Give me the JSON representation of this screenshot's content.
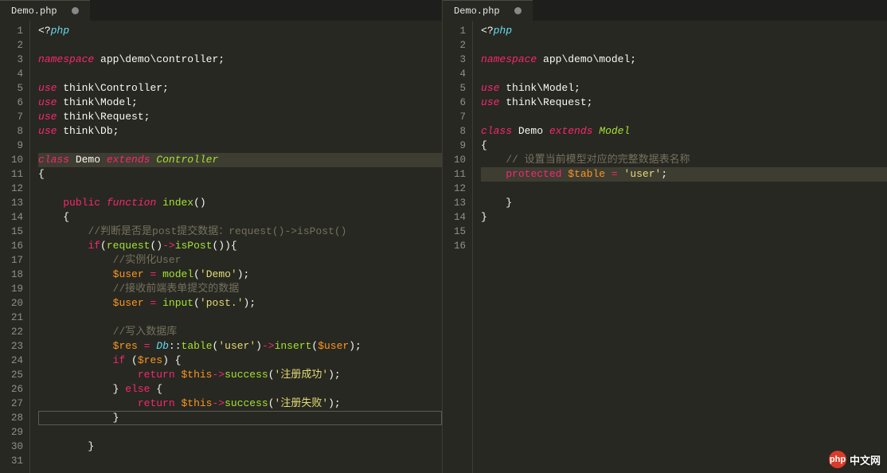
{
  "left": {
    "tab_label": "Demo.php",
    "line_count": 31,
    "lines": [
      {
        "n": 1,
        "t": [
          {
            "c": "tk-ident",
            "v": "<?"
          },
          {
            "c": "tk-kwblue",
            "v": "php"
          }
        ]
      },
      {
        "n": 2,
        "t": []
      },
      {
        "n": 3,
        "t": [
          {
            "c": "tk-kw",
            "v": "namespace"
          },
          {
            "c": "tk-ident",
            "v": " app\\demo\\controller;"
          }
        ]
      },
      {
        "n": 4,
        "t": []
      },
      {
        "n": 5,
        "t": [
          {
            "c": "tk-kw",
            "v": "use"
          },
          {
            "c": "tk-ident",
            "v": " think\\Controller;"
          }
        ]
      },
      {
        "n": 6,
        "t": [
          {
            "c": "tk-kw",
            "v": "use"
          },
          {
            "c": "tk-ident",
            "v": " think\\Model;"
          }
        ]
      },
      {
        "n": 7,
        "t": [
          {
            "c": "tk-kw",
            "v": "use"
          },
          {
            "c": "tk-ident",
            "v": " think\\Request;"
          }
        ]
      },
      {
        "n": 8,
        "t": [
          {
            "c": "tk-kw",
            "v": "use"
          },
          {
            "c": "tk-ident",
            "v": " think\\Db;"
          }
        ]
      },
      {
        "n": 9,
        "t": []
      },
      {
        "n": 10,
        "t": [
          {
            "c": "tk-kw",
            "v": "class"
          },
          {
            "c": "tk-ident",
            "v": " Demo "
          },
          {
            "c": "tk-kw",
            "v": "extends"
          },
          {
            "c": "tk-ident",
            "v": " "
          },
          {
            "c": "tk-cls",
            "v": "Controller"
          }
        ],
        "hl": true
      },
      {
        "n": 11,
        "t": [
          {
            "c": "tk-ident",
            "v": "{"
          }
        ]
      },
      {
        "n": 12,
        "t": []
      },
      {
        "n": 13,
        "t": [
          {
            "c": "tk-ident",
            "v": "    "
          },
          {
            "c": "tk-kw2",
            "v": "public"
          },
          {
            "c": "tk-ident",
            "v": " "
          },
          {
            "c": "tk-kw",
            "v": "function"
          },
          {
            "c": "tk-ident",
            "v": " "
          },
          {
            "c": "tk-fn",
            "v": "index"
          },
          {
            "c": "tk-ident",
            "v": "()"
          }
        ]
      },
      {
        "n": 14,
        "t": [
          {
            "c": "tk-ident",
            "v": "    {"
          }
        ]
      },
      {
        "n": 15,
        "t": [
          {
            "c": "tk-ident",
            "v": "        "
          },
          {
            "c": "tk-cmt",
            "v": "//判断是否是post提交数据：request()->isPost()"
          }
        ]
      },
      {
        "n": 16,
        "t": [
          {
            "c": "tk-ident",
            "v": "        "
          },
          {
            "c": "tk-kw2",
            "v": "if"
          },
          {
            "c": "tk-ident",
            "v": "("
          },
          {
            "c": "tk-fn",
            "v": "request"
          },
          {
            "c": "tk-ident",
            "v": "()"
          },
          {
            "c": "tk-op",
            "v": "->"
          },
          {
            "c": "tk-fn",
            "v": "isPost"
          },
          {
            "c": "tk-ident",
            "v": "()){"
          }
        ]
      },
      {
        "n": 17,
        "t": [
          {
            "c": "tk-ident",
            "v": "            "
          },
          {
            "c": "tk-cmt",
            "v": "//实例化User"
          }
        ]
      },
      {
        "n": 18,
        "t": [
          {
            "c": "tk-ident",
            "v": "            "
          },
          {
            "c": "tk-var",
            "v": "$user"
          },
          {
            "c": "tk-ident",
            "v": " "
          },
          {
            "c": "tk-op",
            "v": "="
          },
          {
            "c": "tk-ident",
            "v": " "
          },
          {
            "c": "tk-fn",
            "v": "model"
          },
          {
            "c": "tk-ident",
            "v": "("
          },
          {
            "c": "tk-str",
            "v": "'Demo'"
          },
          {
            "c": "tk-ident",
            "v": ");"
          }
        ]
      },
      {
        "n": 19,
        "t": [
          {
            "c": "tk-ident",
            "v": "            "
          },
          {
            "c": "tk-cmt",
            "v": "//接收前端表单提交的数据"
          }
        ]
      },
      {
        "n": 20,
        "t": [
          {
            "c": "tk-ident",
            "v": "            "
          },
          {
            "c": "tk-var",
            "v": "$user"
          },
          {
            "c": "tk-ident",
            "v": " "
          },
          {
            "c": "tk-op",
            "v": "="
          },
          {
            "c": "tk-ident",
            "v": " "
          },
          {
            "c": "tk-fn",
            "v": "input"
          },
          {
            "c": "tk-ident",
            "v": "("
          },
          {
            "c": "tk-str",
            "v": "'post.'"
          },
          {
            "c": "tk-ident",
            "v": ");"
          }
        ]
      },
      {
        "n": 21,
        "t": []
      },
      {
        "n": 22,
        "t": [
          {
            "c": "tk-ident",
            "v": "            "
          },
          {
            "c": "tk-cmt",
            "v": "//写入数据库"
          }
        ]
      },
      {
        "n": 23,
        "t": [
          {
            "c": "tk-ident",
            "v": "            "
          },
          {
            "c": "tk-var",
            "v": "$res"
          },
          {
            "c": "tk-ident",
            "v": " "
          },
          {
            "c": "tk-op",
            "v": "="
          },
          {
            "c": "tk-ident",
            "v": " "
          },
          {
            "c": "tk-static",
            "v": "Db"
          },
          {
            "c": "tk-ident",
            "v": "::"
          },
          {
            "c": "tk-fn",
            "v": "table"
          },
          {
            "c": "tk-ident",
            "v": "("
          },
          {
            "c": "tk-str",
            "v": "'user'"
          },
          {
            "c": "tk-ident",
            "v": ")"
          },
          {
            "c": "tk-op",
            "v": "->"
          },
          {
            "c": "tk-fn",
            "v": "insert"
          },
          {
            "c": "tk-ident",
            "v": "("
          },
          {
            "c": "tk-var",
            "v": "$user"
          },
          {
            "c": "tk-ident",
            "v": ");"
          }
        ]
      },
      {
        "n": 24,
        "t": [
          {
            "c": "tk-ident",
            "v": "            "
          },
          {
            "c": "tk-kw2",
            "v": "if"
          },
          {
            "c": "tk-ident",
            "v": " ("
          },
          {
            "c": "tk-var",
            "v": "$res"
          },
          {
            "c": "tk-ident",
            "v": ") {"
          }
        ]
      },
      {
        "n": 25,
        "t": [
          {
            "c": "tk-ident",
            "v": "                "
          },
          {
            "c": "tk-kw2",
            "v": "return"
          },
          {
            "c": "tk-ident",
            "v": " "
          },
          {
            "c": "tk-var",
            "v": "$this"
          },
          {
            "c": "tk-op",
            "v": "->"
          },
          {
            "c": "tk-fn",
            "v": "success"
          },
          {
            "c": "tk-ident",
            "v": "("
          },
          {
            "c": "tk-str",
            "v": "'注册成功'"
          },
          {
            "c": "tk-ident",
            "v": ");"
          }
        ]
      },
      {
        "n": 26,
        "t": [
          {
            "c": "tk-ident",
            "v": "            } "
          },
          {
            "c": "tk-kw2",
            "v": "else"
          },
          {
            "c": "tk-ident",
            "v": " {"
          }
        ]
      },
      {
        "n": 27,
        "t": [
          {
            "c": "tk-ident",
            "v": "                "
          },
          {
            "c": "tk-kw2",
            "v": "return"
          },
          {
            "c": "tk-ident",
            "v": " "
          },
          {
            "c": "tk-var",
            "v": "$this"
          },
          {
            "c": "tk-op",
            "v": "->"
          },
          {
            "c": "tk-fn",
            "v": "success"
          },
          {
            "c": "tk-ident",
            "v": "("
          },
          {
            "c": "tk-str",
            "v": "'注册失败'"
          },
          {
            "c": "tk-ident",
            "v": ");"
          }
        ]
      },
      {
        "n": 28,
        "t": [
          {
            "c": "tk-ident",
            "v": "            }"
          }
        ],
        "boxed": true
      },
      {
        "n": 29,
        "t": []
      },
      {
        "n": 30,
        "t": [
          {
            "c": "tk-ident",
            "v": "        }"
          }
        ]
      },
      {
        "n": 31,
        "t": []
      }
    ]
  },
  "right": {
    "tab_label": "Demo.php",
    "line_count": 16,
    "lines": [
      {
        "n": 1,
        "t": [
          {
            "c": "tk-ident",
            "v": "<?"
          },
          {
            "c": "tk-kwblue",
            "v": "php"
          }
        ]
      },
      {
        "n": 2,
        "t": []
      },
      {
        "n": 3,
        "t": [
          {
            "c": "tk-kw",
            "v": "namespace"
          },
          {
            "c": "tk-ident",
            "v": " app\\demo\\model;"
          }
        ]
      },
      {
        "n": 4,
        "t": []
      },
      {
        "n": 5,
        "t": [
          {
            "c": "tk-kw",
            "v": "use"
          },
          {
            "c": "tk-ident",
            "v": " think\\Model;"
          }
        ]
      },
      {
        "n": 6,
        "t": [
          {
            "c": "tk-kw",
            "v": "use"
          },
          {
            "c": "tk-ident",
            "v": " think\\Request;"
          }
        ]
      },
      {
        "n": 7,
        "t": []
      },
      {
        "n": 8,
        "t": [
          {
            "c": "tk-kw",
            "v": "class"
          },
          {
            "c": "tk-ident",
            "v": " Demo "
          },
          {
            "c": "tk-kw",
            "v": "extends"
          },
          {
            "c": "tk-ident",
            "v": " "
          },
          {
            "c": "tk-cls",
            "v": "Model"
          }
        ]
      },
      {
        "n": 9,
        "t": [
          {
            "c": "tk-ident",
            "v": "{"
          }
        ]
      },
      {
        "n": 10,
        "t": [
          {
            "c": "tk-ident",
            "v": "    "
          },
          {
            "c": "tk-cmt",
            "v": "// 设置当前模型对应的完整数据表名称"
          }
        ]
      },
      {
        "n": 11,
        "t": [
          {
            "c": "tk-ident",
            "v": "    "
          },
          {
            "c": "tk-kw2",
            "v": "protected"
          },
          {
            "c": "tk-ident",
            "v": " "
          },
          {
            "c": "tk-var",
            "v": "$table"
          },
          {
            "c": "tk-ident",
            "v": " "
          },
          {
            "c": "tk-op",
            "v": "="
          },
          {
            "c": "tk-ident",
            "v": " "
          },
          {
            "c": "tk-str",
            "v": "'user'"
          },
          {
            "c": "tk-ident",
            "v": ";"
          }
        ],
        "hl": true
      },
      {
        "n": 12,
        "t": []
      },
      {
        "n": 13,
        "t": [
          {
            "c": "tk-ident",
            "v": "    }"
          }
        ]
      },
      {
        "n": 14,
        "t": [
          {
            "c": "tk-ident",
            "v": "}"
          }
        ]
      },
      {
        "n": 15,
        "t": []
      },
      {
        "n": 16,
        "t": []
      }
    ]
  },
  "watermark": {
    "brand_short": "php",
    "brand_text": "中文网"
  }
}
